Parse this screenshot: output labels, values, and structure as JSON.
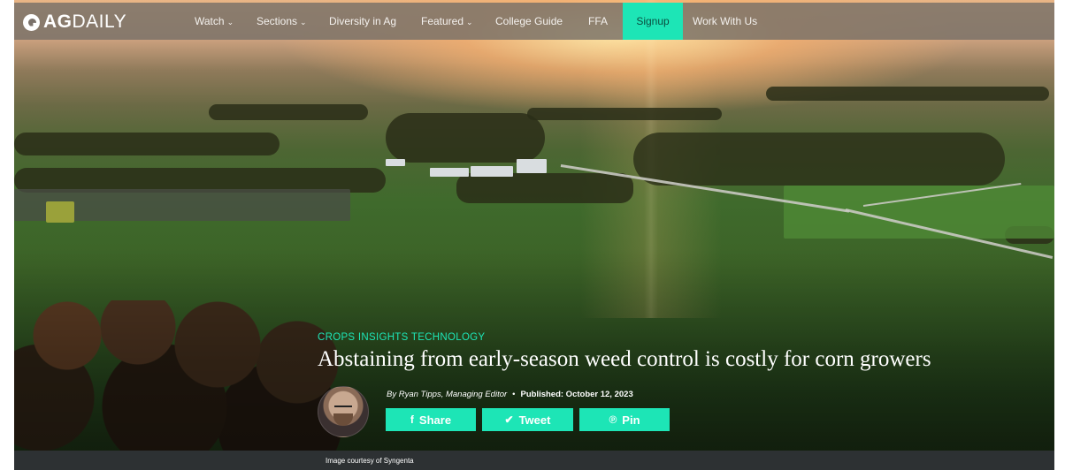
{
  "brand": {
    "logo_bold": "AG",
    "logo_light": "DAILY"
  },
  "nav": {
    "items": [
      {
        "label": "Watch",
        "dropdown": true
      },
      {
        "label": "Sections",
        "dropdown": true
      },
      {
        "label": "Diversity in Ag",
        "dropdown": false
      },
      {
        "label": "Featured",
        "dropdown": true
      },
      {
        "label": "College Guide",
        "dropdown": false
      },
      {
        "label": "FFA",
        "dropdown": false
      },
      {
        "label": "Signup",
        "dropdown": false,
        "highlighted": true
      },
      {
        "label": "Work With Us",
        "dropdown": false
      }
    ],
    "caret_icon": "chevron-down-icon"
  },
  "article": {
    "category": "CROPS INSIGHTS TECHNOLOGY",
    "headline": "Abstaining from early-season weed control is costly for corn growers",
    "author": "By Ryan Tipps, Managing Editor",
    "separator": "•",
    "published": "Published: October 12, 2023",
    "image_caption": "Image courtesy of Syngenta"
  },
  "share": {
    "facebook": {
      "label": "Share",
      "icon": "facebook-icon",
      "glyph": "f"
    },
    "twitter": {
      "label": "Tweet",
      "icon": "twitter-icon",
      "glyph": "🐦"
    },
    "pinterest": {
      "label": "Pin",
      "icon": "pinterest-icon",
      "glyph": "ᑭ"
    }
  },
  "colors": {
    "accent": "#1de5b6",
    "navbar": "#787068",
    "caption_bar": "#2d3133"
  }
}
